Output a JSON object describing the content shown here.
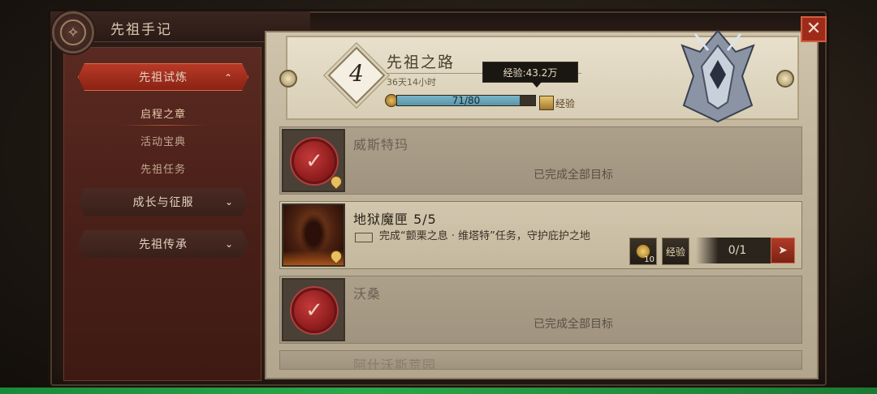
{
  "header": {
    "title": "先祖手记",
    "emblem_icon": "ancestor-emblem-icon"
  },
  "sidebar": {
    "main_tabs": [
      {
        "label": "先祖试炼",
        "expanded": true
      },
      {
        "label": "成长与征服",
        "expanded": false
      },
      {
        "label": "先祖传承",
        "expanded": false
      }
    ],
    "sub_items": [
      {
        "label": "启程之章",
        "active": true
      },
      {
        "label": "活动宝典",
        "active": false
      },
      {
        "label": "先祖任务",
        "active": false
      }
    ]
  },
  "path": {
    "level": "4",
    "title": "先祖之路",
    "time_left": "36天14小时",
    "xp_text": "71/80",
    "xp_fraction": 0.8875,
    "tooltip": "经验:43.2万",
    "reward_label": "经验"
  },
  "close_label": "✕",
  "quests": [
    {
      "name": "威斯特玛",
      "status": "已完成全部目标",
      "completed": true
    },
    {
      "name": "地狱魔匣 5/5",
      "objective": "完成“颤栗之息 · 维塔特”任务，守护庇护之地",
      "reward_count": "10",
      "reward_label": "经验",
      "progress": "0/1",
      "completed": false
    },
    {
      "name": "沃桑",
      "status": "已完成全部目标",
      "completed": true
    },
    {
      "name": "阿什沃斯荒园",
      "completed": false
    }
  ],
  "colors": {
    "accent_red": "#a02a1a",
    "xp_fill": "#7ab4c8",
    "parchment": "#cfc3ac"
  }
}
